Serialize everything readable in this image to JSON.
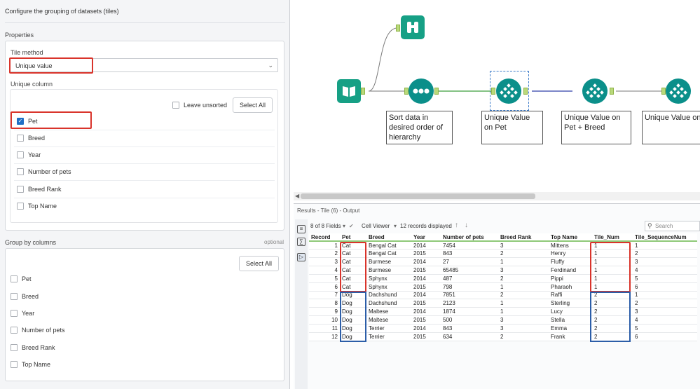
{
  "config": {
    "title": "Configure the grouping of datasets (tiles)",
    "properties_label": "Properties",
    "tile_method_label": "Tile method",
    "tile_method_value": "Unique value",
    "unique_column_label": "Unique column",
    "leave_unsorted_label": "Leave unsorted",
    "select_all_label": "Select All",
    "unique_columns": [
      {
        "label": "Pet",
        "checked": true
      },
      {
        "label": "Breed",
        "checked": false
      },
      {
        "label": "Year",
        "checked": false
      },
      {
        "label": "Number of pets",
        "checked": false
      },
      {
        "label": "Breed Rank",
        "checked": false
      },
      {
        "label": "Top Name",
        "checked": false
      }
    ],
    "group_by_label": "Group by columns",
    "optional_label": "optional",
    "group_select_all_label": "Select All",
    "group_columns": [
      {
        "label": "Pet"
      },
      {
        "label": "Breed"
      },
      {
        "label": "Year"
      },
      {
        "label": "Number of pets"
      },
      {
        "label": "Breed Rank"
      },
      {
        "label": "Top Name"
      }
    ]
  },
  "canvas": {
    "notes": {
      "sort": "Sort data in desired order of hierarchy",
      "tile1": "Unique Value on Pet",
      "tile2": "Unique Value on Pet + Breed",
      "tile3": "Unique Value on Pet + Breed + Yea"
    },
    "colors": {
      "tool_teal": "#0b8f8a",
      "tool_green": "#16a085",
      "anchor": "#b9d97a"
    }
  },
  "results": {
    "title": "Results - Tile (6) - Output",
    "fields_label": "8 of 8 Fields",
    "cell_viewer_label": "Cell Viewer",
    "records_label": "12 records displayed",
    "search_placeholder": "Search",
    "columns": [
      "Record",
      "Pet",
      "Breed",
      "Year",
      "Number of pets",
      "Breed Rank",
      "Top Name",
      "Tile_Num",
      "Tile_SequenceNum"
    ],
    "rows": [
      [
        "1",
        "Cat",
        "Bengal Cat",
        "2014",
        "7454",
        "3",
        "Mittens",
        "1",
        "1"
      ],
      [
        "2",
        "Cat",
        "Bengal Cat",
        "2015",
        "843",
        "2",
        "Henry",
        "1",
        "2"
      ],
      [
        "3",
        "Cat",
        "Burmese",
        "2014",
        "27",
        "1",
        "Fluffy",
        "1",
        "3"
      ],
      [
        "4",
        "Cat",
        "Burmese",
        "2015",
        "65485",
        "3",
        "Ferdinand",
        "1",
        "4"
      ],
      [
        "5",
        "Cat",
        "Sphynx",
        "2014",
        "487",
        "2",
        "Pippi",
        "1",
        "5"
      ],
      [
        "6",
        "Cat",
        "Sphynx",
        "2015",
        "798",
        "1",
        "Pharaoh",
        "1",
        "6"
      ],
      [
        "7",
        "Dog",
        "Dachshund",
        "2014",
        "7851",
        "2",
        "Raffi",
        "2",
        "1"
      ],
      [
        "8",
        "Dog",
        "Dachshund",
        "2015",
        "2123",
        "1",
        "Sterling",
        "2",
        "2"
      ],
      [
        "9",
        "Dog",
        "Maltese",
        "2014",
        "1874",
        "1",
        "Lucy",
        "2",
        "3"
      ],
      [
        "10",
        "Dog",
        "Maltese",
        "2015",
        "500",
        "3",
        "Stella",
        "2",
        "4"
      ],
      [
        "11",
        "Dog",
        "Terrier",
        "2014",
        "843",
        "3",
        "Emma",
        "2",
        "5"
      ],
      [
        "12",
        "Dog",
        "Terrier",
        "2015",
        "634",
        "2",
        "Frank",
        "2",
        "6"
      ]
    ]
  }
}
